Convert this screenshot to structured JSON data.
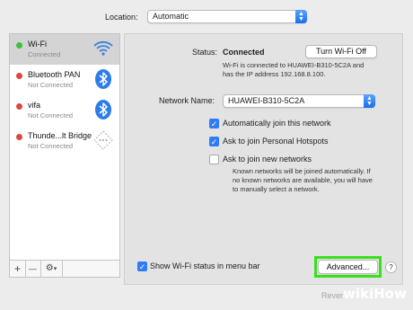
{
  "location": {
    "label": "Location:",
    "value": "Automatic"
  },
  "services": [
    {
      "name": "Wi-Fi",
      "status": "Connected",
      "dot_color": "#3cc13b",
      "icon": "wifi-icon",
      "selected": true
    },
    {
      "name": "Bluetooth PAN",
      "status": "Not Connected",
      "dot_color": "#e0443e",
      "icon": "bluetooth-icon",
      "selected": false
    },
    {
      "name": "vifa",
      "status": "Not Connected",
      "dot_color": "#e0443e",
      "icon": "bluetooth-icon",
      "selected": false
    },
    {
      "name": "Thunde...lt Bridge",
      "status": "Not Connected",
      "dot_color": "#e0443e",
      "icon": "thunderbolt-bridge-icon",
      "selected": false
    }
  ],
  "sidebar_actions": {
    "add": "+",
    "remove": "—",
    "gear": "⚙",
    "gear_chevron": "▾"
  },
  "status": {
    "label": "Status:",
    "value": "Connected",
    "toggle_button": "Turn Wi-Fi Off",
    "desc_line1": "Wi-Fi is connected to HUAWEI-B310-5C2A and",
    "desc_line2": "has the IP address 192.168.8.100."
  },
  "network": {
    "label": "Network Name:",
    "value": "HUAWEI-B310-5C2A"
  },
  "options": {
    "auto_join": {
      "label": "Automatically join this network",
      "checked": true
    },
    "hotspots": {
      "label": "Ask to join Personal Hotspots",
      "checked": true
    },
    "new_networks": {
      "label": "Ask to join new networks",
      "checked": false
    },
    "new_desc_line1": "Known networks will be joined automatically. If",
    "new_desc_line2": "no known networks are available, you will have",
    "new_desc_line3": "to manually select a network."
  },
  "menu_bar": {
    "label": "Show Wi-Fi status in menu bar",
    "checked": true
  },
  "advanced_button": "Advanced...",
  "help_button": "?",
  "revert_button": "Rever",
  "watermark": {
    "wiki": "wiki",
    "how": "How"
  },
  "colors": {
    "accent": "#2f7cf6",
    "highlight": "#39e01d",
    "connected": "#3cc13b",
    "disconnected": "#e0443e"
  }
}
